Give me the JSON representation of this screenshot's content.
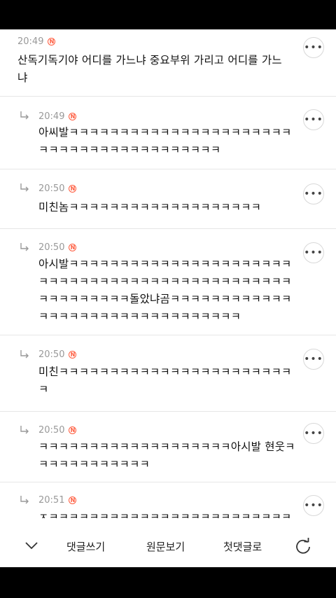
{
  "comments": [
    {
      "time": "20:49",
      "badge": "N",
      "reply": false,
      "text": "산독기독기야 어디를 가느냐 중요부위 가리고 어디를 가느\n냐",
      "more": "•••"
    },
    {
      "time": "20:49",
      "badge": "N",
      "reply": true,
      "text": "아씨발ㅋㅋㅋㅋㅋㅋㅋㅋㅋㅋㅋㅋㅋㅋㅋㅋㅋㅋㅋㅋㅋㅋ\nㅋㅋㅋㅋㅋㅋㅋㅋㅋㅋㅋㅋㅋㅋㅋㅋㅋㅋ",
      "more": "•••"
    },
    {
      "time": "20:50",
      "badge": "N",
      "reply": true,
      "text": "미친놈ㅋㅋㅋㅋㅋㅋㅋㅋㅋㅋㅋㅋㅋㅋㅋㅋㅋㅋㅋ",
      "more": "•••"
    },
    {
      "time": "20:50",
      "badge": "N",
      "reply": true,
      "text": "아시발ㅋㅋㅋㅋㅋㅋㅋㅋㅋㅋㅋㅋㅋㅋㅋㅋㅋㅋㅋㅋㅋㅋ\nㅋㅋㅋㅋㅋㅋㅋㅋㅋㅋㅋㅋㅋㅋㅋㅋㅋㅋㅋㅋㅋㅋㅋㅋㅋ\nㅋㅋㅋㅋㅋㅋㅋㅋㅋ돌았냐곰ㅋㅋㅋㅋㅋㅋㅋㅋㅋㅋㅋㅋ\nㅋㅋㅋㅋㅋㅋㅋㅋㅋㅋㅋㅋㅋㅋㅋㅋㅋㅋㅋㅋ",
      "more": "•••"
    },
    {
      "time": "20:50",
      "badge": "N",
      "reply": true,
      "text": "미친ㅋㅋㅋㅋㅋㅋㅋㅋㅋㅋㅋㅋㅋㅋㅋㅋㅋㅋㅋㅋㅋㅋㅋ\nㅋ",
      "more": "•••"
    },
    {
      "time": "20:50",
      "badge": "N",
      "reply": true,
      "text": "ㅋㅋㅋㅋㅋㅋㅋㅋㅋㅋㅋㅋㅋㅋㅋㅋㅋㅋㅋ아시발 현웃ㅋ\nㅋㅋㅋㅋㅋㅋㅋㅋㅋㅋㅋ",
      "more": "•••"
    },
    {
      "time": "20:51",
      "badge": "N",
      "reply": true,
      "text": "ㅈㅋㅋㅋㅋㅋㅋㅋㅋㅋㅋㅋㅋㅋㅋㅋㅋㅋㅋㅋㅋㅋㅋㅋㅋ",
      "more": "•••"
    }
  ],
  "bottom_bar": {
    "write_comment": "댓글쓰기",
    "view_original": "원문보기",
    "first_comment": "첫댓글로",
    "chevron_icon": "chevron-down-icon",
    "refresh_icon": "refresh-icon"
  }
}
